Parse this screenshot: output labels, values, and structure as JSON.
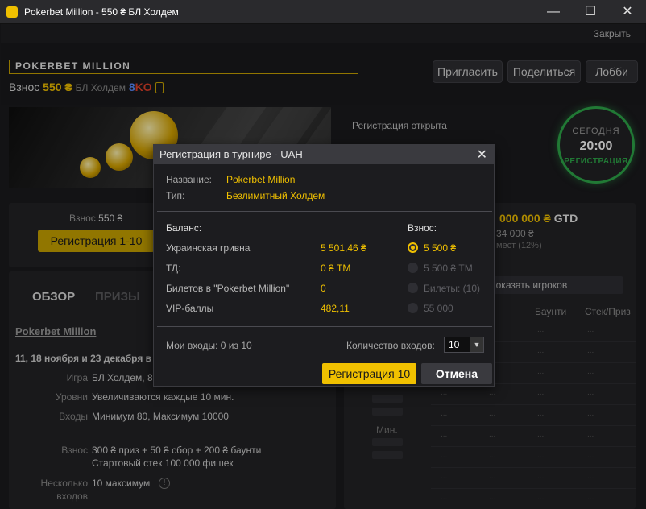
{
  "window": {
    "title": "Pokerbet Million - 550 ₴ БЛ Холдем",
    "minimize": "—",
    "maximize": "☐",
    "close": "✕"
  },
  "topbar": {
    "close_link": "Закрыть"
  },
  "header": {
    "brand": "POKERBET MILLION",
    "entry_label": "Взнос",
    "entry_amount": "550 ₴",
    "game": "БЛ Холдем",
    "ko_count": "8",
    "ko_label": "KO",
    "buttons": {
      "invite": "Пригласить",
      "share": "Поделиться",
      "lobby": "Лобби"
    }
  },
  "status": {
    "registration_open": "Регистрация открыта"
  },
  "clock": {
    "day": "СЕГОДНЯ",
    "time": "20:00",
    "state": "РЕГИСТРАЦИЯ"
  },
  "left_panel": {
    "fee_label": "Взнос",
    "fee_value": "550 ₴",
    "register_button": "Регистрация 1-10"
  },
  "right_panel": {
    "prize": "000 000 ₴",
    "prize_suffix": "GTD",
    "sub1": "34 000 ₴",
    "sub2": "мест (12%)",
    "show_players": "Показать игроков",
    "columns": [
      "Баунти",
      "Стек/Приз"
    ],
    "min_label": "Мин.",
    "cell_placeholder": "..."
  },
  "info": {
    "tabs": [
      "ОБЗОР",
      "ПРИЗЫ"
    ],
    "link": "Pokerbet Million",
    "dates": "11, 18 ноября и 23 декабря в",
    "rows": [
      {
        "k": "Игра",
        "v": "БЛ Холдем, 8"
      },
      {
        "k": "Уровни",
        "v": "Увеличиваются каждые 10 мин."
      },
      {
        "k": "Входы",
        "v": "Минимум 80, Максимум 10000"
      },
      {
        "k": "Взнос",
        "v": "300 ₴ приз + 50 ₴ сбор + 200 ₴ баунти"
      },
      {
        "k": "",
        "v": "Стартовый стек 100 000 фишек"
      },
      {
        "k": "Несколько",
        "v": "10 максимум"
      },
      {
        "k": "входов",
        "v": ""
      }
    ],
    "warn_icon": "!"
  },
  "dialog": {
    "title": "Регистрация в турнире - UAH",
    "close": "✕",
    "name_label": "Название:",
    "name_value": "Pokerbet Million",
    "type_label": "Тип:",
    "type_value": "Безлимитный Холдем",
    "balance_heading": "Баланс:",
    "fee_heading": "Взнос:",
    "balances": [
      {
        "label": "Украинская гривна",
        "value": "5 501,46 ₴"
      },
      {
        "label": "ТД:",
        "value": "0 ₴ ТМ"
      },
      {
        "label": "Билетов в \"Pokerbet Million\"",
        "value": "0"
      },
      {
        "label": "VIP-баллы",
        "value": "482,11"
      }
    ],
    "fee_options": [
      {
        "label": "5 500 ₴",
        "selected": true
      },
      {
        "label": "5 500 ₴ ТМ",
        "selected": false
      },
      {
        "label": "Билеты: (10)",
        "selected": false
      },
      {
        "label": "55 000",
        "selected": false
      }
    ],
    "my_entries": "Мои входы:  0 из 10",
    "entries_count_label": "Количество входов:",
    "entries_count_value": "10",
    "select_arrow": "▼",
    "register_button": "Регистрация 10",
    "cancel_button": "Отмена"
  },
  "colors": {
    "accent": "#f0c000",
    "success": "#2fa84a",
    "ko_blue": "#5b8cff",
    "ko_red": "#e0402a"
  }
}
